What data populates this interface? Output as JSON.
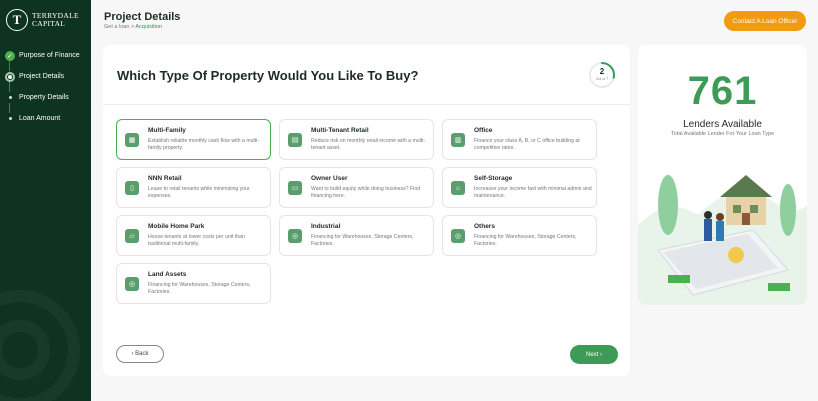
{
  "brand": {
    "mark": "T",
    "name_line1": "TERRYDALE",
    "name_line2": "CAPITAL"
  },
  "sidebar": {
    "steps": [
      {
        "label": "Purpose of Finance",
        "state": "done"
      },
      {
        "label": "Project Details",
        "state": "current"
      },
      {
        "label": "Property Details",
        "state": "pending"
      },
      {
        "label": "Loan Amount",
        "state": "pending"
      }
    ]
  },
  "header": {
    "title": "Project Details",
    "breadcrumb_root": "Get a loan",
    "breadcrumb_sep": ">",
    "breadcrumb_current": "Acquisition",
    "contact_label": "Contact A Loan Officer"
  },
  "question": {
    "text": "Which Type Of Property Would You Like To Buy?",
    "progress_current": "2",
    "progress_label": "Out of 7",
    "progress_fraction": 0.2857
  },
  "property_types": [
    {
      "title": "Multi-Family",
      "desc": "Establish reliable monthly cash flow with a multi-family property.",
      "icon": "apartment-icon",
      "selected": true
    },
    {
      "title": "Multi-Tenant Retail",
      "desc": "Reduce risk on monthly retail income with a multi-tenant asset.",
      "icon": "storefront-icon",
      "selected": false
    },
    {
      "title": "Office",
      "desc": "Finance your class A, B, or C office building at competitive rates.",
      "icon": "office-icon",
      "selected": false
    },
    {
      "title": "NNN Retail",
      "desc": "Lease to retail tenants while minimizing your expenses.",
      "icon": "retail-icon",
      "selected": false
    },
    {
      "title": "Owner User",
      "desc": "Want to build equity while doing business? Find financing here.",
      "icon": "owner-icon",
      "selected": false
    },
    {
      "title": "Self-Storage",
      "desc": "Increases your income fast with minimal admin and maintenance.",
      "icon": "storage-icon",
      "selected": false
    },
    {
      "title": "Mobile Home Park",
      "desc": "House tenants at lower costs per unit than traditional multi-family.",
      "icon": "mobile-home-icon",
      "selected": false
    },
    {
      "title": "Industrial",
      "desc": "Financing for Warehouses, Storage Centers, Factories.",
      "icon": "industrial-icon",
      "selected": false
    },
    {
      "title": "Others",
      "desc": "Financing for Warehouses, Storage Centers, Factories.",
      "icon": "others-icon",
      "selected": false
    },
    {
      "title": "Land Assets",
      "desc": "Financing for Warehouses, Storage Centers, Factories.",
      "icon": "land-icon",
      "selected": false
    }
  ],
  "nav": {
    "back_label": "‹ Back",
    "next_label": "Next ›"
  },
  "lenders": {
    "count": "761",
    "label": "Lenders Available",
    "sub": "Total Available Lender For Your Loan Type"
  },
  "colors": {
    "sidebar_bg": "#0f3321",
    "accent_green": "#3d9b57",
    "accent_orange": "#f29a12"
  }
}
